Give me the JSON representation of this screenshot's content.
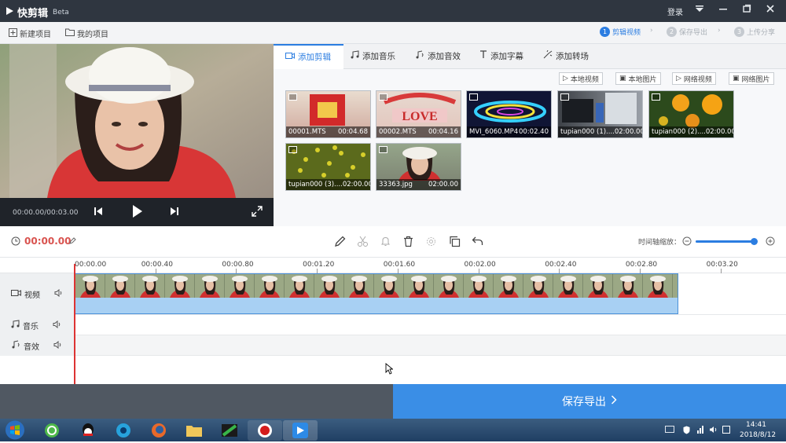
{
  "app": {
    "title": "快剪辑",
    "beta": "Beta"
  },
  "window_controls": {
    "login": "登录"
  },
  "toolbar": {
    "new_project": "新建项目",
    "my_projects": "我的项目"
  },
  "steps": [
    {
      "num": "1",
      "label": "剪辑视频"
    },
    {
      "num": "2",
      "label": "保存导出"
    },
    {
      "num": "3",
      "label": "上传分享"
    }
  ],
  "preview": {
    "timecode": "00:00.00/00:03.00"
  },
  "tabs": [
    {
      "label": "添加剪辑"
    },
    {
      "label": "添加音乐"
    },
    {
      "label": "添加音效"
    },
    {
      "label": "添加字幕"
    },
    {
      "label": "添加转场"
    }
  ],
  "sources": {
    "local_video": "本地视频",
    "local_image": "本地图片",
    "web_video": "网络视频",
    "web_image": "网络图片"
  },
  "media": [
    {
      "name": "00001.MTS",
      "duration": "00:04.68"
    },
    {
      "name": "00002.MTS",
      "duration": "00:04.16"
    },
    {
      "name": "MVI_6060.MP4",
      "duration": "00:02.40"
    },
    {
      "name": "tupian000 (1)....",
      "duration": "02:00.00"
    },
    {
      "name": "tupian000 (2)....",
      "duration": "02:00.00"
    },
    {
      "name": "tupian000 (3)....",
      "duration": "02:00.00"
    },
    {
      "name": "33363.jpg",
      "duration": "02:00.00"
    }
  ],
  "editbar": {
    "current_time": "00:00.00",
    "zoom_label": "时间轴缩放：",
    "zoom_level": 0.95
  },
  "ruler": [
    "00:00.00",
    "00:00.40",
    "00:00.80",
    "00:01.20",
    "00:01.60",
    "00:02.00",
    "00:02.40",
    "00:02.80",
    "00:03.20"
  ],
  "tracks": {
    "video": "视频",
    "music": "音乐",
    "sfx": "音效"
  },
  "export": {
    "label": "保存导出"
  },
  "taskbar": {
    "time": "14:41",
    "date": "2018/8/12"
  },
  "colors": {
    "accent": "#2b7de1",
    "export": "#3a8ee6",
    "title_bg": "#2f3640",
    "clip": "#a8d0f3"
  }
}
